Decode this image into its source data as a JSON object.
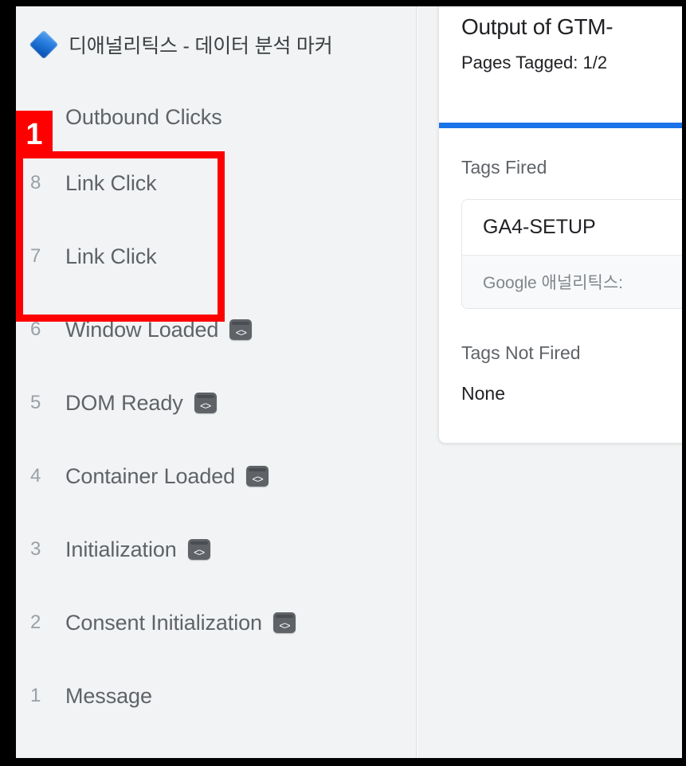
{
  "window": {
    "container_header": {
      "icon": "blue-diamond-icon",
      "title": "디애널리틱스 - 데이터 분석 마커"
    },
    "summary_row": {
      "index": "",
      "label": "Outbound Clicks"
    },
    "events": [
      {
        "index": "8",
        "label": "Link Click",
        "has_code_icon": false
      },
      {
        "index": "7",
        "label": "Link Click",
        "has_code_icon": false
      },
      {
        "index": "6",
        "label": "Window Loaded",
        "has_code_icon": true
      },
      {
        "index": "5",
        "label": "DOM Ready",
        "has_code_icon": true
      },
      {
        "index": "4",
        "label": "Container Loaded",
        "has_code_icon": true
      },
      {
        "index": "3",
        "label": "Initialization",
        "has_code_icon": true
      },
      {
        "index": "2",
        "label": "Consent Initialization",
        "has_code_icon": true
      },
      {
        "index": "1",
        "label": "Message",
        "has_code_icon": false
      }
    ],
    "code_icon_glyph": "<>"
  },
  "output_card": {
    "title": "Output of GTM-",
    "subtitle": "Pages Tagged: 1/2",
    "tags_fired": {
      "heading": "Tags Fired",
      "items": [
        {
          "name": "GA4-SETUP",
          "type": "Google 애널리틱스:"
        }
      ]
    },
    "tags_not_fired": {
      "heading": "Tags Not Fired",
      "value": "None"
    }
  },
  "annotations": {
    "badge_label": "1",
    "accent_color": "#ff0000"
  }
}
